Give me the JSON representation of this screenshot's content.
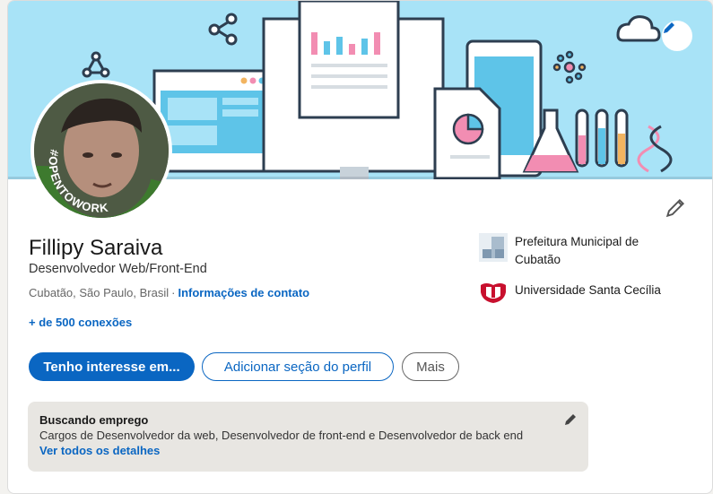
{
  "profile": {
    "name": "Fillipy Saraiva",
    "headline": "Desenvolvedor Web/Front-End",
    "location": "Cubatão, São Paulo, Brasil",
    "contact_link": "Informações de contato",
    "connections": "+ de 500 conexões",
    "avatar_frame_text": "#OPENTOWORK"
  },
  "organizations": [
    {
      "name": "Prefeitura Municipal de Cubatão",
      "icon": "building-logo"
    },
    {
      "name": "Universidade Santa Cecília",
      "icon": "university-crest"
    }
  ],
  "actions": {
    "primary": "Tenho interesse em...",
    "add_section": "Adicionar seção do perfil",
    "more": "Mais"
  },
  "open_to_work": {
    "title": "Buscando emprego",
    "description": "Cargos de Desenvolvedor da web, Desenvolvedor de front-end e Desenvolvedor de back end",
    "link": "Ver todos os detalhes"
  },
  "colors": {
    "accent": "#0a66c2",
    "open_to_work_green": "#3d7a2e",
    "banner_bg": "#a8e3f7"
  }
}
